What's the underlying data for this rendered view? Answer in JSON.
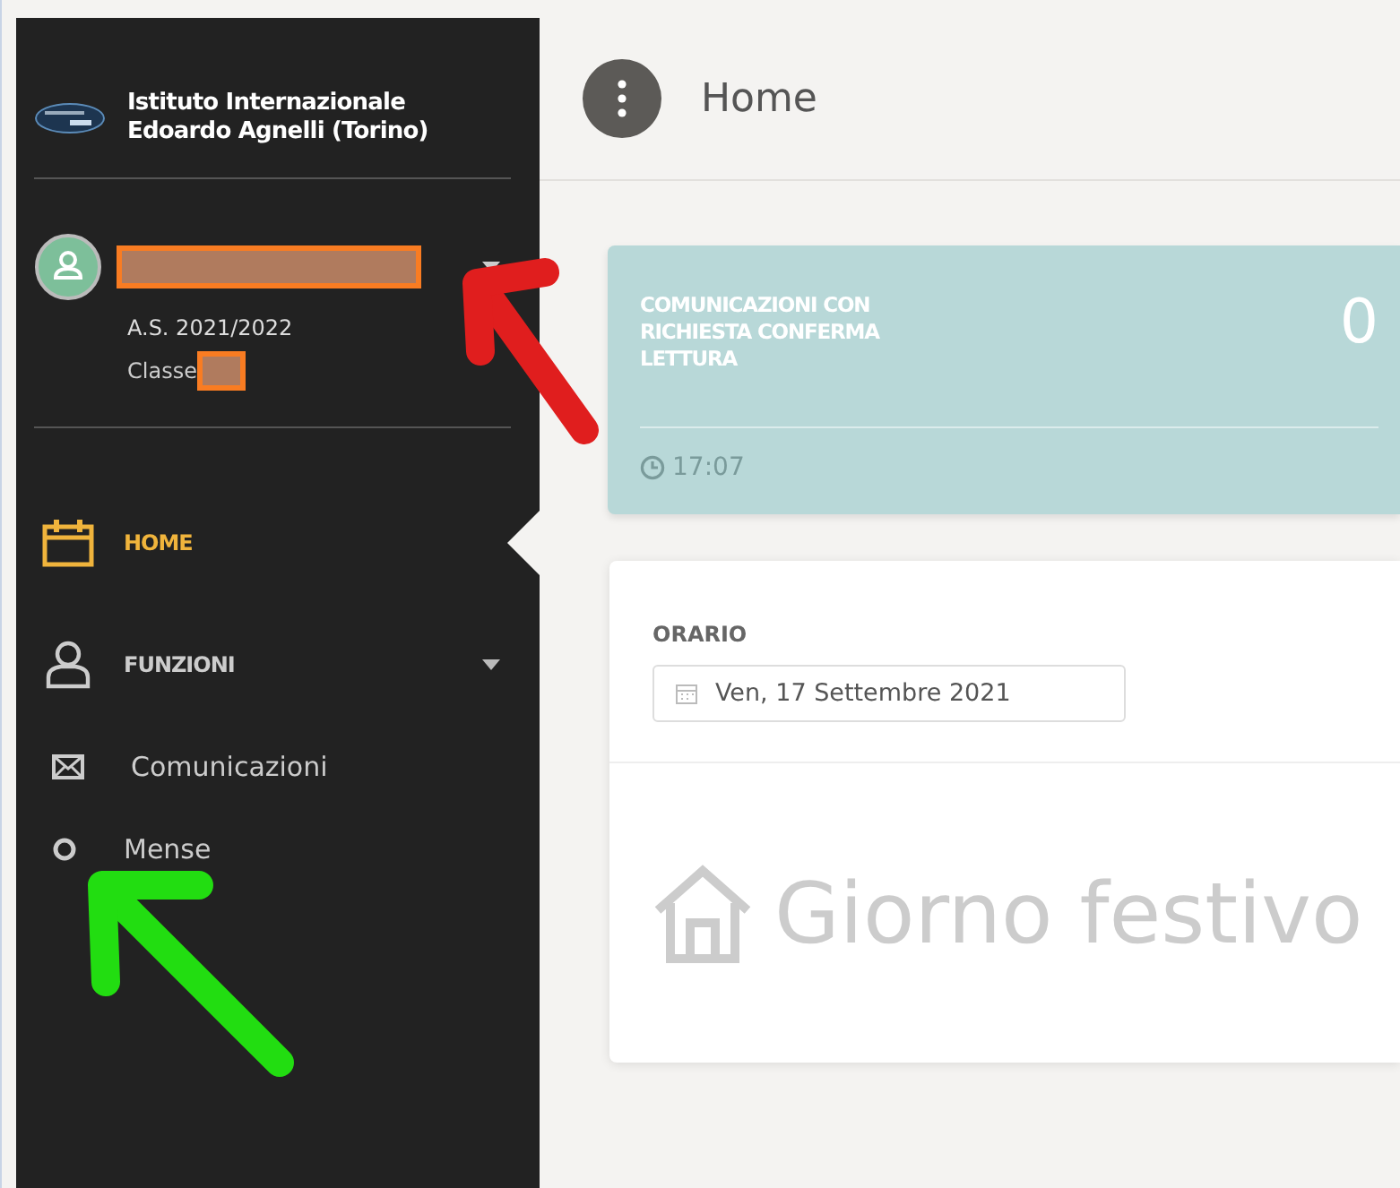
{
  "sidebar": {
    "school": "Istituto Internazionale Edoardo Agnelli (Torino)",
    "user": {
      "name_redacted": true,
      "year": "A.S. 2021/2022",
      "class_label": "Classe",
      "class_redacted": true
    },
    "items": [
      {
        "label": "HOME",
        "kind": "section",
        "selected": true,
        "has_caret": false
      },
      {
        "label": "FUNZIONI",
        "kind": "section",
        "selected": false,
        "has_caret": true
      },
      {
        "label": "Comunicazioni",
        "kind": "link",
        "selected": false,
        "has_caret": false
      },
      {
        "label": "Mense",
        "kind": "link",
        "selected": false,
        "has_caret": false
      }
    ]
  },
  "header": {
    "title": "Home"
  },
  "stat_card": {
    "label": "COMUNICAZIONI CON RICHIESTA CONFERMA LETTURA",
    "count": "0",
    "time": "17:07"
  },
  "schedule": {
    "title": "ORARIO",
    "date": "Ven, 17 Settembre 2021",
    "message": "Giorno festivo"
  },
  "annotations": [
    {
      "kind": "arrow",
      "color": "#e01e1e"
    },
    {
      "kind": "arrow",
      "color": "#22dd11"
    }
  ]
}
